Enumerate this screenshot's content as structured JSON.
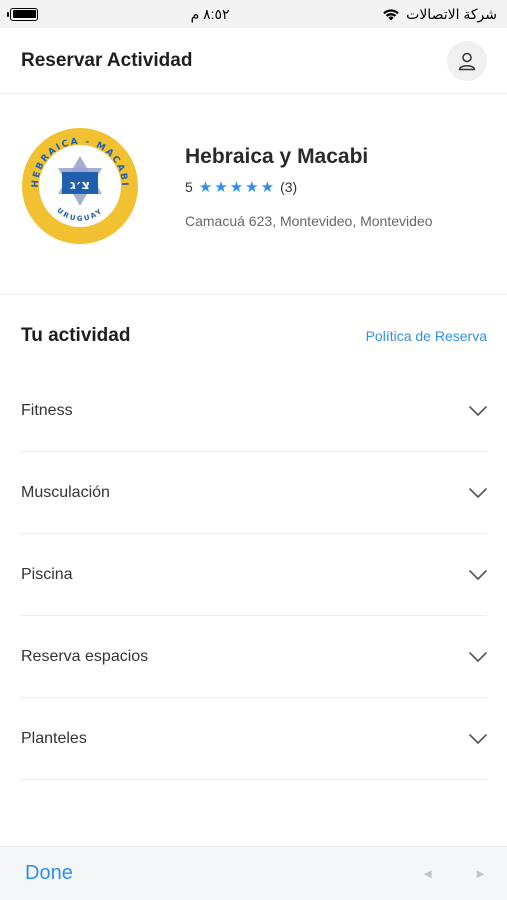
{
  "status_bar": {
    "time": "٨:٥٢ م",
    "carrier": "شركة الاتصالات",
    "battery_level": 1.0
  },
  "header": {
    "title": "Reservar Actividad"
  },
  "club": {
    "name": "Hebraica y Macabi",
    "rating_score": "5",
    "rating_stars": 5,
    "review_count": "(3)",
    "address": "Camacuá 623, Montevideo, Montevideo",
    "logo_text_top": "HEBRAICA - MACABI",
    "logo_text_bottom": "URUGUAY"
  },
  "activity": {
    "title": "Tu actividad",
    "policy_link": "Política de Reserva",
    "items": [
      {
        "label": "Fitness"
      },
      {
        "label": "Musculación"
      },
      {
        "label": "Piscina"
      },
      {
        "label": "Reserva espacios"
      },
      {
        "label": "Planteles"
      }
    ]
  },
  "toolbar": {
    "done_label": "Done",
    "prev_glyph": "◄",
    "next_glyph": "►"
  },
  "colors": {
    "accent": "#2f8ff0",
    "logo_ring": "#f2c132",
    "logo_blue": "#1f5fae"
  }
}
